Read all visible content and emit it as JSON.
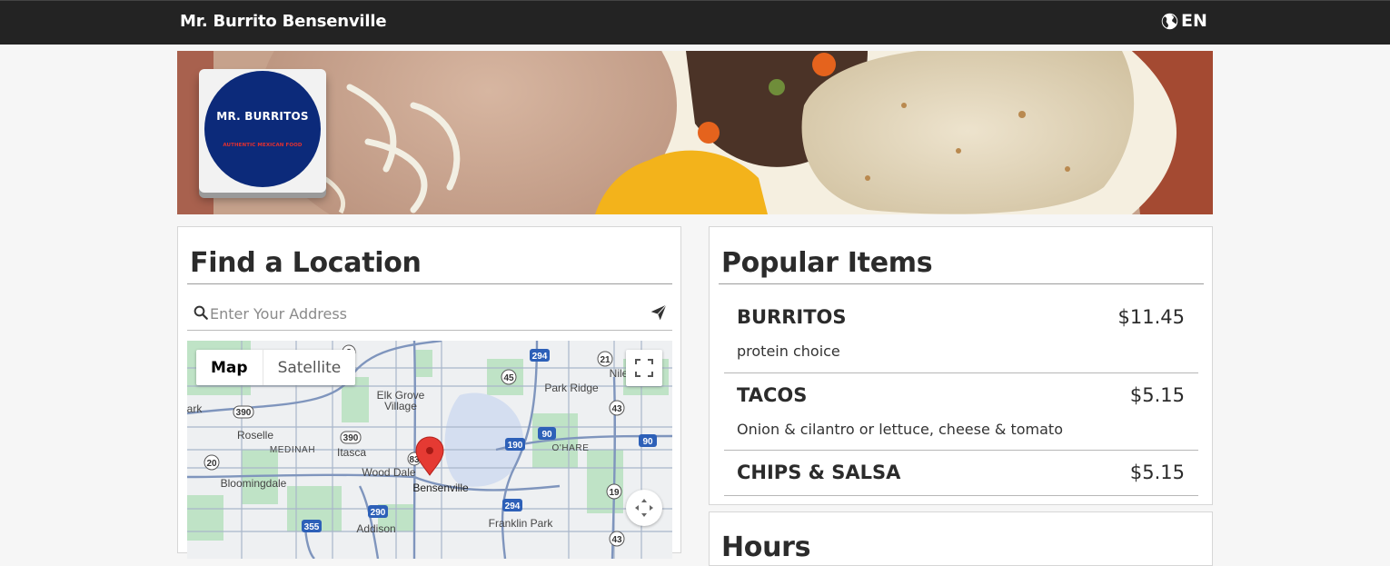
{
  "header": {
    "brand": "Mr. Burrito Bensenville",
    "language": "EN",
    "language_icon": "globe-icon"
  },
  "logo": {
    "name": "MR. BURRITOS",
    "tagline": "AUTHENTIC MEXICAN FOOD"
  },
  "locator": {
    "title": "Find a Location",
    "search_placeholder": "Enter Your Address",
    "search_icon": "search-icon",
    "submit_icon": "send-icon",
    "map": {
      "type_map": "Map",
      "type_satellite": "Satellite",
      "labels": {
        "elk_grove": "Elk Grove",
        "village": "Village",
        "park_ridge": "Park Ridge",
        "nile": "Nile",
        "ark": "ark",
        "roselle": "Roselle",
        "medinah": "MEDINAH",
        "itasca": "Itasca",
        "wood_dale": "Wood Dale",
        "ohare": "O'HARE",
        "bloomingdale": "Bloomingdale",
        "bensenville": "Bensenville",
        "addison": "Addison",
        "franklin_park": "Franklin Park"
      },
      "shields": {
        "s294a": "294",
        "s2": "2",
        "s21": "21",
        "s45": "45",
        "s43a": "43",
        "s390a": "390",
        "s390b": "390",
        "s190": "190",
        "s90a": "90",
        "s90b": "90",
        "s20": "20",
        "s83": "83",
        "s19": "19",
        "s290": "290",
        "s294b": "294",
        "s355": "355",
        "s43b": "43"
      }
    }
  },
  "popular": {
    "title": "Popular Items",
    "items": [
      {
        "name": "BURRITOS",
        "price": "$11.45",
        "description": "protein choice"
      },
      {
        "name": "TACOS",
        "price": "$5.15",
        "description": "Onion & cilantro or lettuce, cheese & tomato"
      },
      {
        "name": "CHIPS & SALSA",
        "price": "$5.15",
        "description": ""
      }
    ]
  },
  "hours": {
    "title": "Hours"
  }
}
